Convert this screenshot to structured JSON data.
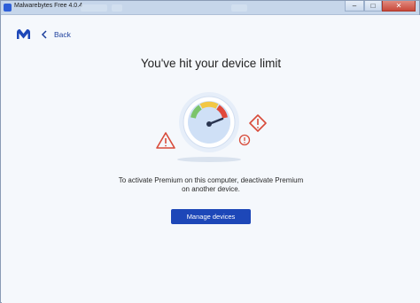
{
  "window": {
    "title": "Malwarebytes Free  4.0.4",
    "controls": {
      "minimize": "–",
      "maximize": "□",
      "close": "✕"
    }
  },
  "nav": {
    "back_label": "Back"
  },
  "main": {
    "headline": "You've hit your device limit",
    "message_line1": "To activate Premium on this computer, deactivate Premium",
    "message_line2": "on another device.",
    "cta_label": "Manage devices"
  },
  "colors": {
    "brand_blue": "#1d47b8",
    "warning_red": "#d84b3a",
    "gauge_green": "#7cc46a",
    "gauge_yellow": "#f2c744",
    "gauge_red": "#e0493c"
  },
  "icons": [
    "malwarebytes-logo",
    "chevron-left-icon",
    "speedometer-icon",
    "warning-triangle-icon",
    "warning-diamond-icon",
    "warning-circle-icon"
  ]
}
